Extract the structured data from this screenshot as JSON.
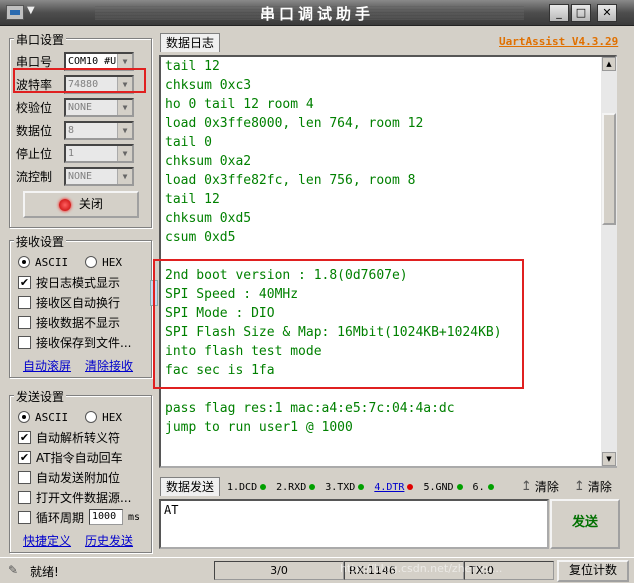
{
  "window": {
    "title": "串口调试助手",
    "menu_caret": "▼",
    "minimize": "_",
    "maximize": "□",
    "close": "✕"
  },
  "serial_settings": {
    "group_title": "串口设置",
    "port_label": "串口号",
    "port_value": "COM10 #U",
    "baud_label": "波特率",
    "baud_value": "74880",
    "parity_label": "校验位",
    "parity_value": "NONE",
    "databits_label": "数据位",
    "databits_value": "8",
    "stopbits_label": "停止位",
    "stopbits_value": "1",
    "flow_label": "流控制",
    "flow_value": "NONE",
    "close_button": "关闭"
  },
  "receive_settings": {
    "group_title": "接收设置",
    "ascii": "ASCII",
    "hex": "HEX",
    "options": [
      {
        "label": "按日志模式显示",
        "checked": true
      },
      {
        "label": "接收区自动换行",
        "checked": false
      },
      {
        "label": "接收数据不显示",
        "checked": false
      },
      {
        "label": "接收保存到文件...",
        "checked": false
      }
    ],
    "auto_clear": "自动滚屏",
    "clear_receive": "清除接收"
  },
  "send_settings": {
    "group_title": "发送设置",
    "ascii": "ASCII",
    "hex": "HEX",
    "options": [
      {
        "label": "自动解析转义符",
        "checked": true
      },
      {
        "label": "AT指令自动回车",
        "checked": true
      },
      {
        "label": "自动发送附加位",
        "checked": false
      },
      {
        "label": "打开文件数据源...",
        "checked": false
      },
      {
        "label": "循环周期",
        "checked": false
      }
    ],
    "period_value": "1000",
    "period_unit": "ms",
    "shortcut_link": "快捷定义",
    "history_link": "历史发送"
  },
  "log": {
    "tab_label": "数据日志",
    "brand": "UartAssist V4.3.29",
    "lines": [
      "tail 12",
      "chksum 0xc3",
      "ho 0 tail 12 room 4",
      "load 0x3ffe8000, len 764, room 12",
      "tail 0",
      "chksum 0xa2",
      "load 0x3ffe82fc, len 756, room 8",
      "tail 12",
      "chksum 0xd5",
      "csum 0xd5",
      "",
      "2nd boot version : 1.8(0d7607e)",
      "SPI Speed : 40MHz",
      "SPI Mode : DIO",
      "SPI Flash Size & Map: 16Mbit(1024KB+1024KB)",
      "into flash test mode",
      "fac sec is 1fa",
      "",
      "pass flag res:1 mac:a4:e5:7c:04:4a:dc",
      "jump to run user1 @ 1000"
    ]
  },
  "send_area": {
    "tab_label": "数据发送",
    "pins": [
      {
        "label": "1.DCD",
        "color": "#00a000"
      },
      {
        "label": "2.RXD",
        "color": "#00a000"
      },
      {
        "label": "3.TXD",
        "color": "#00a000"
      },
      {
        "label": "4.DTR",
        "color": "#e00000"
      },
      {
        "label": "5.GND",
        "color": "#00a000"
      },
      {
        "label": "6.",
        "color": "#00a000"
      }
    ],
    "clear1": "清除",
    "clear2": "清除",
    "text": "AT",
    "send_button": "发送"
  },
  "status": {
    "ready": "就绪!",
    "counter": "3/0",
    "rx": "RX:1146",
    "tx": "TX:0",
    "reset": "复位计数",
    "watermark": "http://blog.csdn.net/zhenyu..."
  }
}
